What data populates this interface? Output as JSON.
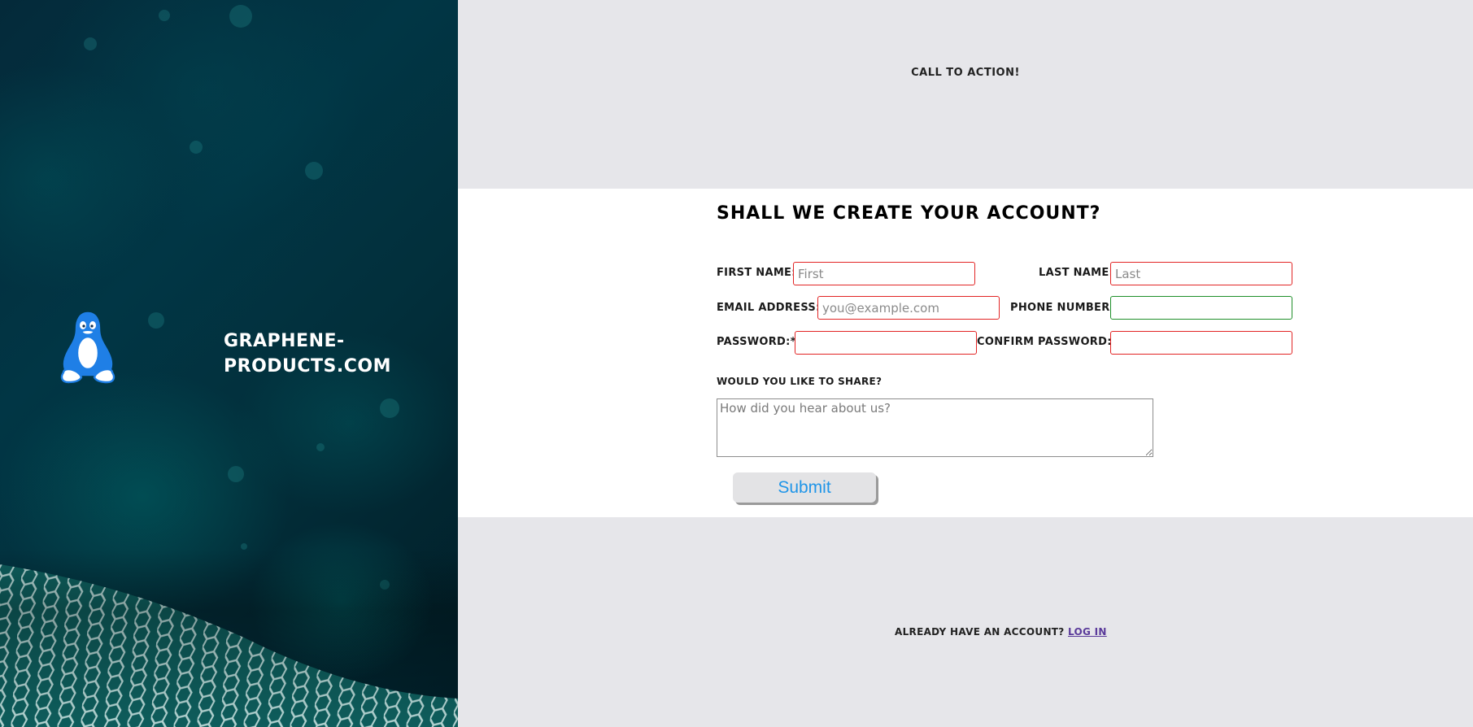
{
  "brand": {
    "name": "GRAPHENE-PRODUCTS.COM",
    "logo_icon": "linux-tux-icon",
    "logo_color": "#1f7fe6"
  },
  "cta": {
    "text": "CALL TO ACTION!"
  },
  "form": {
    "title": "SHALL WE CREATE YOUR ACCOUNT?",
    "first_name": {
      "label": "FIRST NAME:",
      "placeholder": "First",
      "value": ""
    },
    "last_name": {
      "label": "LAST NAME:",
      "placeholder": "Last",
      "value": ""
    },
    "email": {
      "label": "EMAIL ADDRESS:",
      "placeholder": "you@example.com",
      "value": ""
    },
    "phone": {
      "label": "PHONE NUMBER:",
      "placeholder": "",
      "value": ""
    },
    "password": {
      "label": "PASSWORD:*",
      "placeholder": "",
      "value": ""
    },
    "confirm_password": {
      "label": "CONFIRM PASSWORD:",
      "placeholder": "",
      "value": ""
    },
    "share": {
      "label": "WOULD YOU LIKE TO SHARE?",
      "placeholder": "How did you hear about us?",
      "value": ""
    },
    "submit_label": "Submit"
  },
  "footer": {
    "already_text": "ALREADY HAVE AN ACCOUNT?",
    "login_label": "LOG IN"
  },
  "colors": {
    "invalid_border": "#e22424",
    "valid_border": "#1f8f2a",
    "submit_text": "#1f95e8",
    "link": "#5a3a9a",
    "panel_bg": "#e6e6ea"
  }
}
